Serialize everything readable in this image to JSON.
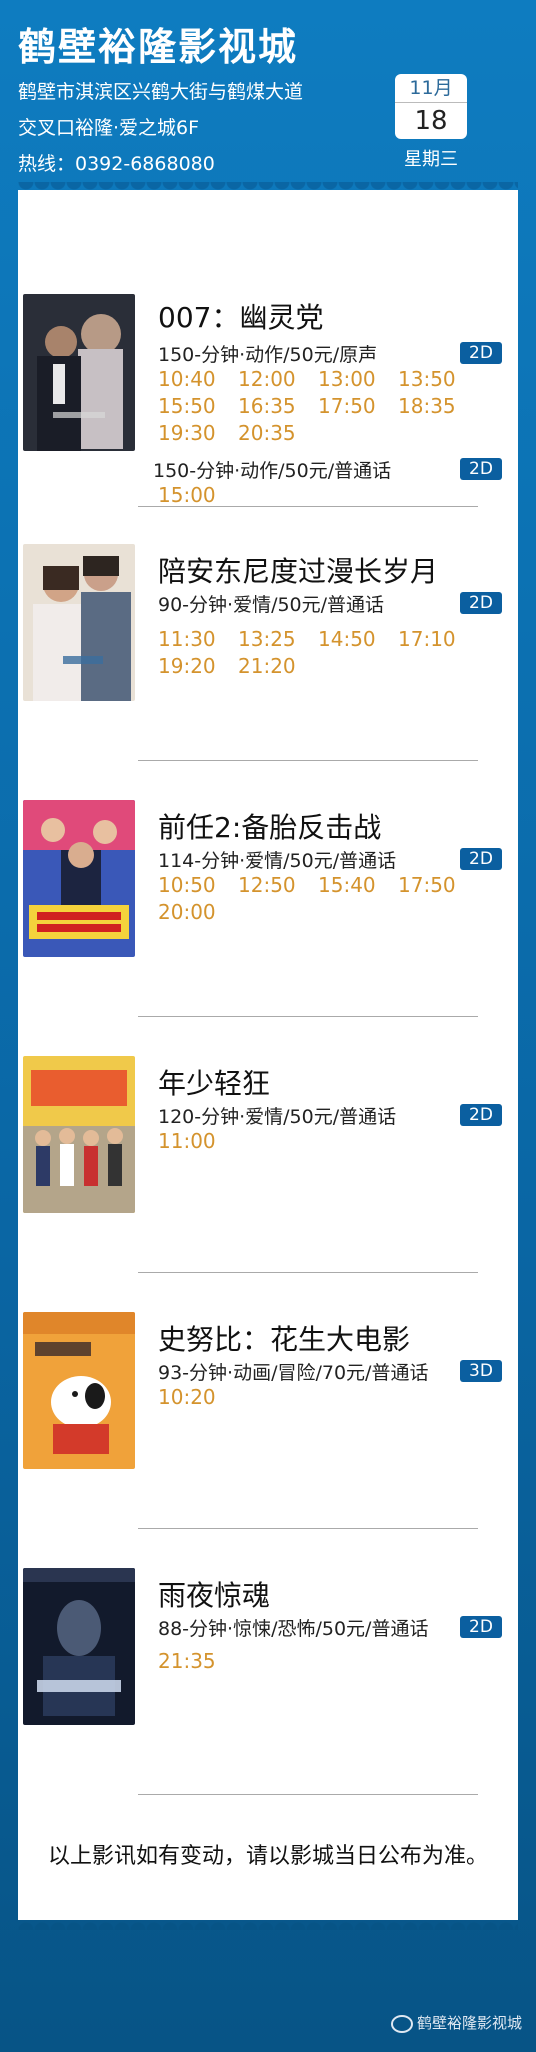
{
  "header": {
    "cinema_name": "鹤壁裕隆影视城",
    "address_line1": "鹤壁市淇滨区兴鹤大街与鹤煤大道",
    "address_line2": "交叉口裕隆·爱之城6F",
    "hotline": "热线：0392-6868080",
    "date": {
      "month": "11月",
      "day": "18",
      "weekday": "星期三"
    }
  },
  "movies": [
    {
      "title": "007：幽灵党",
      "versions": [
        {
          "info": "150-分钟·动作/50元/原声",
          "format": "2D",
          "times": [
            "10:40",
            "12:00",
            "13:00",
            "13:50",
            "15:50",
            "16:35",
            "17:50",
            "18:35",
            "19:30",
            "20:35"
          ]
        },
        {
          "info": "150-分钟·动作/50元/普通话",
          "format": "2D",
          "times": [
            "15:00"
          ]
        }
      ]
    },
    {
      "title": "陪安东尼度过漫长岁月",
      "versions": [
        {
          "info": "90-分钟·爱情/50元/普通话",
          "format": "2D",
          "times": [
            "11:30",
            "13:25",
            "14:50",
            "17:10",
            "19:20",
            "21:20"
          ]
        }
      ]
    },
    {
      "title": "前任2:备胎反击战",
      "versions": [
        {
          "info": "114-分钟·爱情/50元/普通话",
          "format": "2D",
          "times": [
            "10:50",
            "12:50",
            "15:40",
            "17:50",
            "20:00"
          ]
        }
      ]
    },
    {
      "title": "年少轻狂",
      "versions": [
        {
          "info": "120-分钟·爱情/50元/普通话",
          "format": "2D",
          "times": [
            "11:00"
          ]
        }
      ]
    },
    {
      "title": "史努比：花生大电影",
      "versions": [
        {
          "info": "93-分钟·动画/冒险/70元/普通话",
          "format": "3D",
          "times": [
            "10:20"
          ]
        }
      ]
    },
    {
      "title": "雨夜惊魂",
      "versions": [
        {
          "info": "88-分钟·惊悚/恐怖/50元/普通话",
          "format": "2D",
          "times": [
            "21:35"
          ]
        }
      ]
    }
  ],
  "footer_note": "以上影讯如有变动，请以影城当日公布为准。",
  "wechat_account": "鹤壁裕隆影视城",
  "colors": {
    "brand_blue": "#0a66a4",
    "time_gold": "#d4932d",
    "badge_blue": "#0b5fa0"
  }
}
